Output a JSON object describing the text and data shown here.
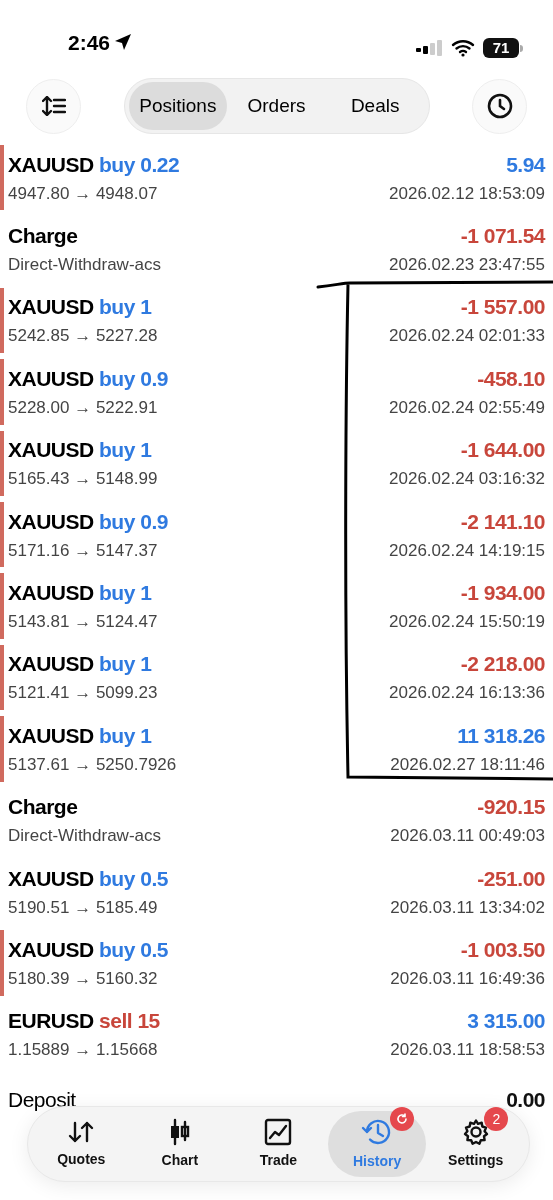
{
  "status_bar": {
    "time": "2:46",
    "battery": "71"
  },
  "tabs": [
    {
      "label": "Positions",
      "selected": true
    },
    {
      "label": "Orders",
      "selected": false
    },
    {
      "label": "Deals",
      "selected": false
    }
  ],
  "rows": [
    {
      "kind": "trade",
      "symbol": "XAUUSD",
      "side": "buy",
      "volume": "0.22",
      "prices": "4947.80 → 4948.07",
      "color": "#2f7ae0",
      "amount": "5.94",
      "time": "2026.02.12 18:53:09",
      "marked": true
    },
    {
      "kind": "charge",
      "symbol": "Charge",
      "comment": "Direct-Withdraw-acs",
      "color": "#c8463b",
      "amount": "-1 071.54",
      "time": "2026.02.23 23:47:55",
      "marked": false
    },
    {
      "kind": "trade",
      "symbol": "XAUUSD",
      "side": "buy",
      "volume": "1",
      "prices": "5242.85 → 5227.28",
      "color": "#c8463b",
      "amount": "-1 557.00",
      "time": "2026.02.24 02:01:33",
      "marked": true
    },
    {
      "kind": "trade",
      "symbol": "XAUUSD",
      "side": "buy",
      "volume": "0.9",
      "prices": "5228.00 → 5222.91",
      "color": "#c8463b",
      "amount": "-458.10",
      "time": "2026.02.24 02:55:49",
      "marked": true
    },
    {
      "kind": "trade",
      "symbol": "XAUUSD",
      "side": "buy",
      "volume": "1",
      "prices": "5165.43 → 5148.99",
      "color": "#c8463b",
      "amount": "-1 644.00",
      "time": "2026.02.24 03:16:32",
      "marked": true
    },
    {
      "kind": "trade",
      "symbol": "XAUUSD",
      "side": "buy",
      "volume": "0.9",
      "prices": "5171.16 → 5147.37",
      "color": "#c8463b",
      "amount": "-2 141.10",
      "time": "2026.02.24 14:19:15",
      "marked": true
    },
    {
      "kind": "trade",
      "symbol": "XAUUSD",
      "side": "buy",
      "volume": "1",
      "prices": "5143.81 → 5124.47",
      "color": "#c8463b",
      "amount": "-1 934.00",
      "time": "2026.02.24 15:50:19",
      "marked": true
    },
    {
      "kind": "trade",
      "symbol": "XAUUSD",
      "side": "buy",
      "volume": "1",
      "prices": "5121.41 → 5099.23",
      "color": "#c8463b",
      "amount": "-2 218.00",
      "time": "2026.02.24 16:13:36",
      "marked": true
    },
    {
      "kind": "trade",
      "symbol": "XAUUSD",
      "side": "buy",
      "volume": "1",
      "prices": "5137.61 → 5250.7926",
      "color": "#2f7ae0",
      "amount": "11 318.26",
      "time": "2026.02.27 18:11:46",
      "marked": true
    },
    {
      "kind": "charge",
      "symbol": "Charge",
      "comment": "Direct-Withdraw-acs",
      "color": "#c8463b",
      "amount": "-920.15",
      "time": "2026.03.11 00:49:03",
      "marked": false
    },
    {
      "kind": "trade",
      "symbol": "XAUUSD",
      "side": "buy",
      "volume": "0.5",
      "prices": "5190.51 → 5185.49",
      "color": "#c8463b",
      "amount": "-251.00",
      "time": "2026.03.11 13:34:02",
      "marked": false
    },
    {
      "kind": "trade",
      "symbol": "XAUUSD",
      "side": "buy",
      "volume": "0.5",
      "prices": "5180.39 → 5160.32",
      "color": "#c8463b",
      "amount": "-1 003.50",
      "time": "2026.03.11 16:49:36",
      "marked": true
    },
    {
      "kind": "trade",
      "symbol": "EURUSD",
      "side": "sell",
      "volume": "15",
      "prices": "1.15889 → 1.15668",
      "color": "#2f7ae0",
      "amount": "3 315.00",
      "time": "2026.03.11 18:58:53",
      "marked": false
    },
    {
      "kind": "balance",
      "symbol": "Deposit",
      "color": "#111111",
      "amount": "0.00",
      "marked": false
    }
  ],
  "nav": [
    {
      "label": "Quotes",
      "selected": false
    },
    {
      "label": "Chart",
      "selected": false
    },
    {
      "label": "Trade",
      "selected": false
    },
    {
      "label": "History",
      "selected": true,
      "badge": {
        "kind": "refresh"
      }
    },
    {
      "label": "Settings",
      "selected": false,
      "badge": {
        "kind": "count",
        "text": "2"
      }
    }
  ]
}
